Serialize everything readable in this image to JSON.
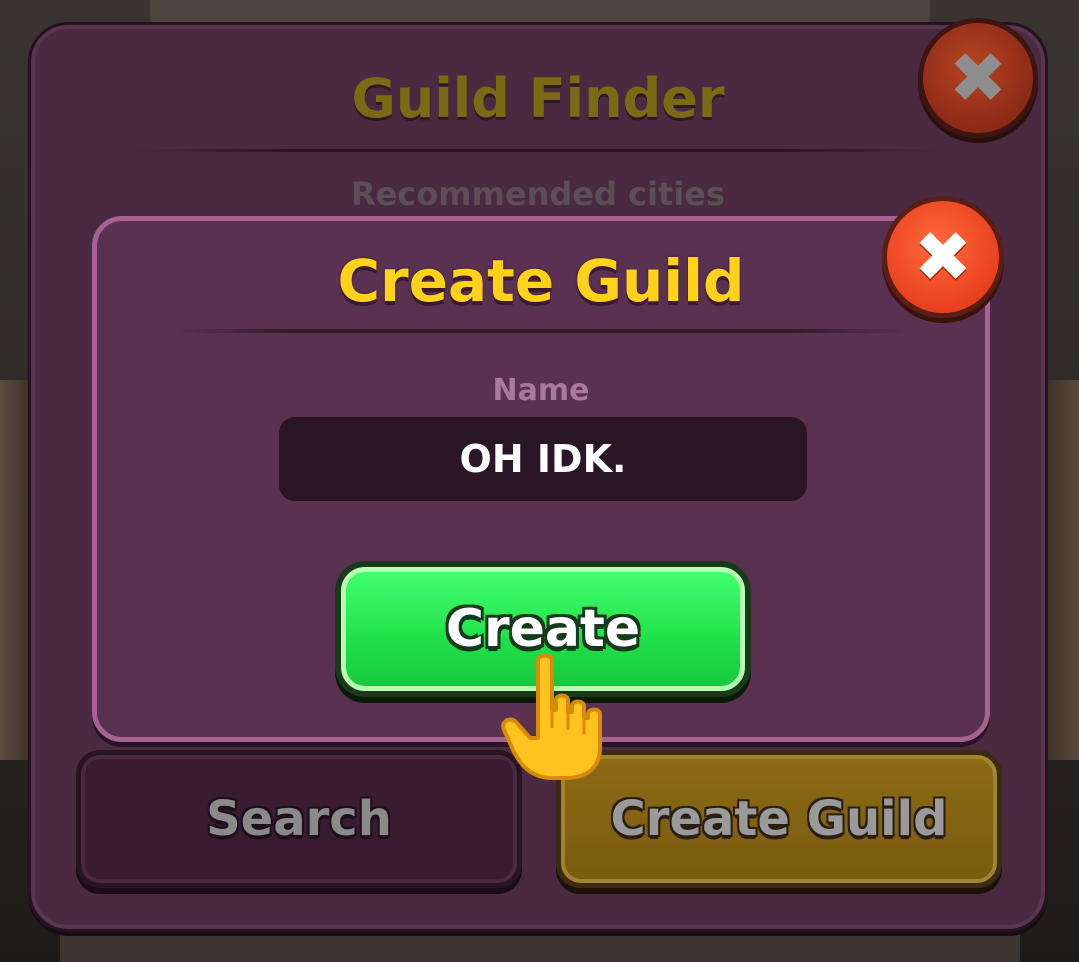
{
  "guild_finder": {
    "title": "Guild Finder",
    "subtitle": "Recommended cities",
    "close_icon": "close-icon",
    "tabs": {
      "search_label": "Search",
      "create_guild_label": "Create Guild"
    }
  },
  "create_guild_dialog": {
    "title": "Create Guild",
    "name_label": "Name",
    "name_value": "OH IDK.",
    "create_button_label": "Create",
    "close_icon": "close-icon"
  },
  "tutorial": {
    "pointer_icon": "pointing-hand-icon"
  },
  "colors": {
    "panel": "#4a2a40",
    "dialog": "#5a3150",
    "title_gold": "#ffd21a",
    "create_green": "#22e04c",
    "close_red": "#e8401e"
  }
}
